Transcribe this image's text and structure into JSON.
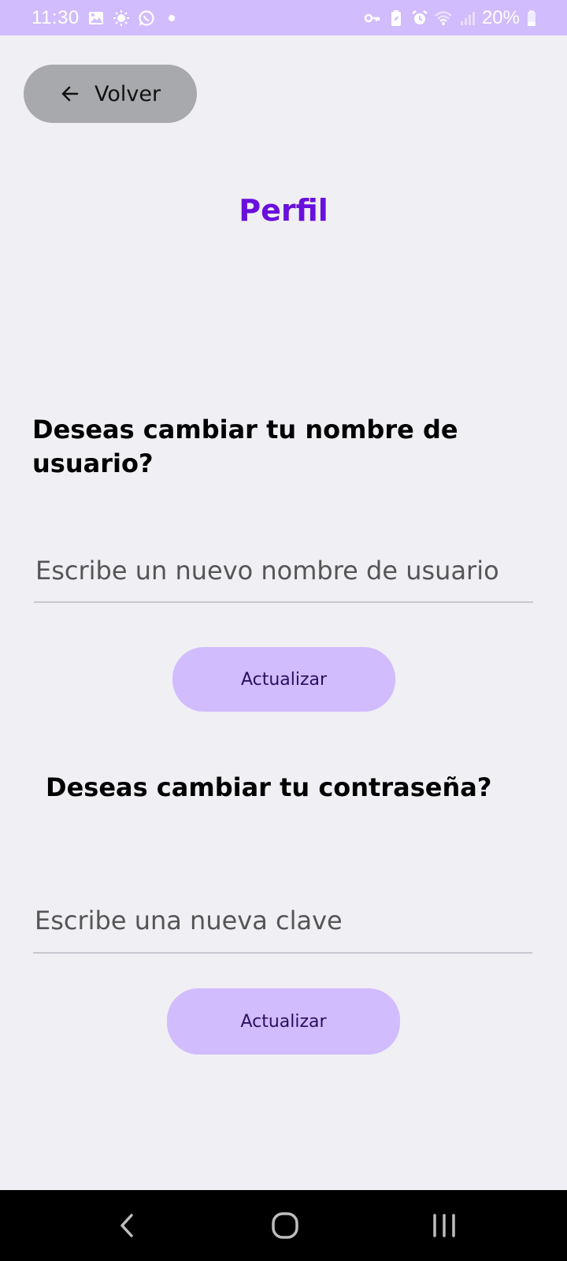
{
  "status_bar": {
    "time": "11:30",
    "battery": "20%",
    "left_icons": [
      "gallery-icon",
      "brightness-icon",
      "whatsapp-icon",
      "dot-icon"
    ],
    "right_icons": [
      "vpn-key-icon",
      "battery-saver-icon",
      "alarm-icon",
      "wifi-icon",
      "signal-icon",
      "battery-icon"
    ],
    "background_color": "#d1bcfd"
  },
  "back_button": {
    "label": "Volver",
    "icon": "arrow-left-icon"
  },
  "page": {
    "title": "Perfil",
    "title_color": "#6a10dc"
  },
  "username_section": {
    "heading": "Deseas cambiar tu nombre de usuario?",
    "input_placeholder": "Escribe un nuevo nombre de usuario",
    "button_label": "Actualizar"
  },
  "password_section": {
    "heading": "Deseas cambiar tu contraseña?",
    "input_placeholder": "Escribe una nueva clave",
    "button_label": "Actualizar"
  },
  "nav_bar": {
    "buttons": [
      "back-icon",
      "home-icon",
      "recents-icon"
    ]
  },
  "colors": {
    "background": "#f0eff4",
    "accent": "#d1bcfd",
    "back_button": "#a8a9ad"
  }
}
